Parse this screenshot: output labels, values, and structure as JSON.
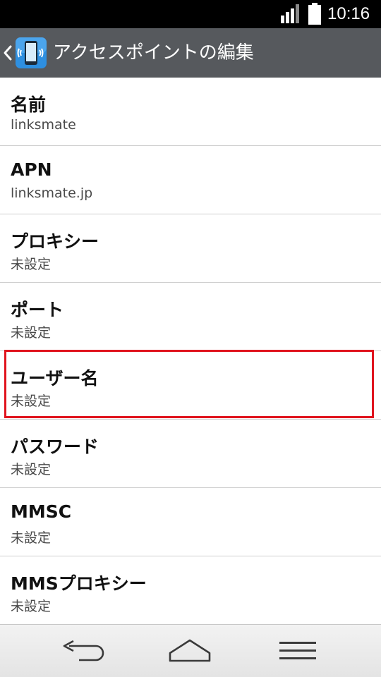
{
  "status_bar": {
    "time": "10:16",
    "signal_icon": "signal-bars-icon",
    "battery_icon": "battery-full-icon"
  },
  "action_bar": {
    "back_icon": "chevron-left-icon",
    "app_icon": "phone-wifi-settings-icon",
    "title": "アクセスポイントの編集"
  },
  "settings": [
    {
      "label": "名前",
      "value": "linksmate"
    },
    {
      "label": "APN",
      "value": "linksmate.jp"
    },
    {
      "label": "プロキシー",
      "value": "未設定"
    },
    {
      "label": "ポート",
      "value": "未設定"
    },
    {
      "label": "ユーザー名",
      "value": "未設定"
    },
    {
      "label": "パスワード",
      "value": "未設定"
    },
    {
      "label": "MMSC",
      "value": "未設定"
    },
    {
      "label": "MMSプロキシー",
      "value": "未設定"
    }
  ],
  "highlight": {
    "target": "ユーザー名",
    "color": "#e0141e"
  },
  "nav_bar": {
    "back_icon": "back-arrow-icon",
    "home_icon": "home-icon",
    "menu_icon": "menu-icon"
  },
  "colors": {
    "action_bar": "#56595d",
    "status_bar": "#000000",
    "divider": "#cfcfcf"
  }
}
